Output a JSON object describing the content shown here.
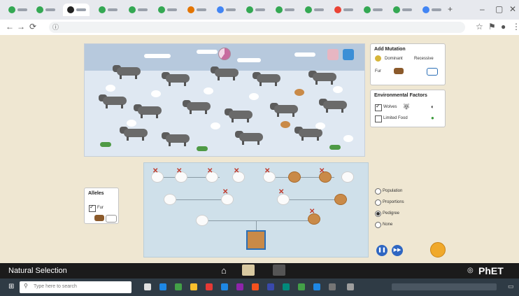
{
  "app_title": "Natural Selection",
  "brand": "PhET",
  "panels": {
    "add_mutation": {
      "title": "Add Mutation",
      "dominant": "Dominant",
      "recessive": "Recessive",
      "fur": "Fur"
    },
    "env_factors": {
      "title": "Environmental Factors",
      "wolves": "Wolves",
      "limited_food": "Limited Food"
    },
    "alleles": {
      "title": "Alleles",
      "fur": "Fur"
    }
  },
  "view_options": [
    "Population",
    "Proportions",
    "Pedigree",
    "None"
  ],
  "taskbar": {
    "search_placeholder": "Type here to search"
  }
}
